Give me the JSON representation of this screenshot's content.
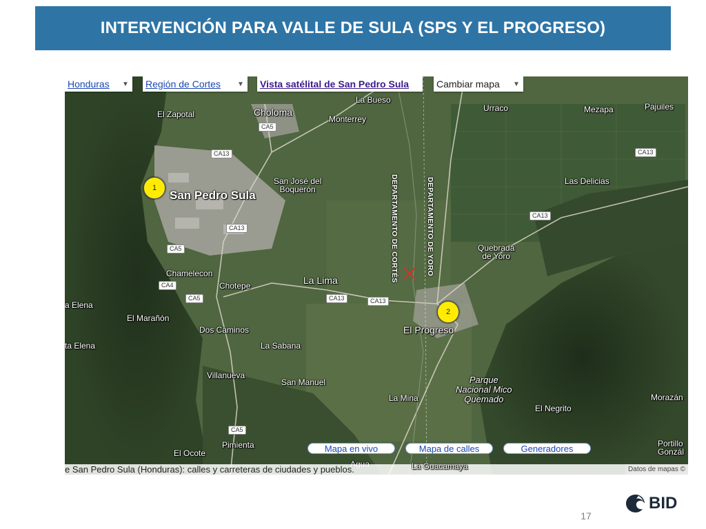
{
  "header": {
    "title": "INTERVENCIÓN PARA VALLE DE SULA (SPS Y EL PROGRESO)"
  },
  "map": {
    "controls": {
      "country": "Honduras",
      "region": "Región de Cortes",
      "satellite": "Vista satélital de San Pedro Sula",
      "change_map": "Cambiar mapa"
    },
    "places": {
      "el_zapotal": "El Zapotal",
      "choloma": "Choloma",
      "la_bueso": "La Bueso",
      "urraco": "Urraco",
      "mezapa": "Mezapa",
      "pajuiles": "Pajuiles",
      "monterrey": "Monterrey",
      "san_jose": "San José del\nBoquerón",
      "san_pedro_sula": "San Pedro Sula",
      "las_delicias": "Las Delicias",
      "quebrada": "Quebrada\nde Yoro",
      "chamelecon": "Chamelecon",
      "chotepe": "Chotepe",
      "la_lima": "La Lima",
      "elena1": "a Elena",
      "el_maranon": "El Marañón",
      "dos_caminos": "Dos Caminos",
      "el_progreso": "El Progreso",
      "elena2": "ta Elena",
      "la_sabana": "La Sabana",
      "villanueva": "Villanueva",
      "san_manuel": "San Manuel",
      "parque": "Parque\nNacional Mico\nQuemado",
      "la_mina": "La Mina",
      "morazan": "Morazán",
      "el_negrito": "El Negrito",
      "pimienta": "Pimienta",
      "el_ocote": "El Ocote",
      "portillo": "Portillo\nGonzál",
      "agua": "Agua",
      "la_guacamaya": "La Guacamaya"
    },
    "depts": {
      "cortes": "DEPARTAMENTO DE CORTÉS",
      "yoro": "DEPARTAMENTO DE YORO"
    },
    "roads": {
      "ca5": "CA5",
      "ca13": "CA13",
      "ca4": "CA4"
    },
    "markers": {
      "m1": "1",
      "m2": "2"
    },
    "buttons": {
      "live": "Mapa en vivo",
      "streets": "Mapa de calles",
      "generators": "Generadores"
    },
    "footer": "e San Pedro Sula (Honduras): calles y carreteras de ciudades y pueblos.",
    "credit": "Datos de mapas ©"
  },
  "page": {
    "number": "17"
  },
  "logo": {
    "text": "BID"
  },
  "colors": {
    "header_bg": "#2e75a6",
    "marker": "#ffec00",
    "link": "#1a47b0"
  }
}
